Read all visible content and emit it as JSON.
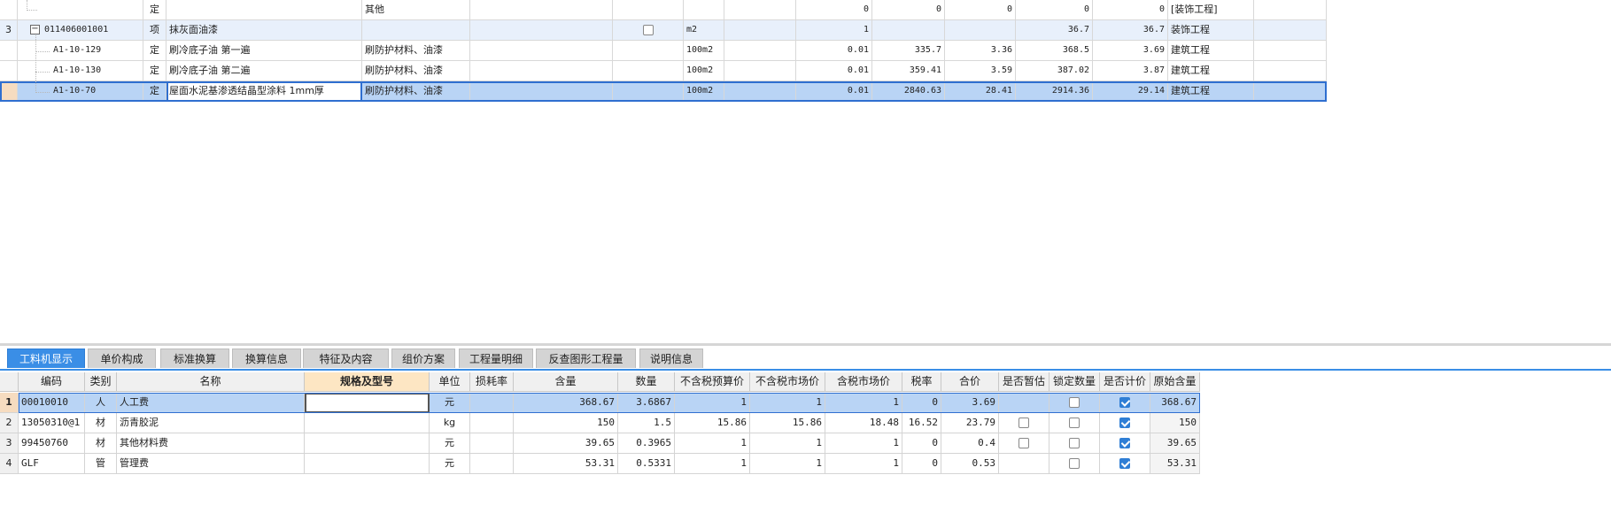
{
  "upper": {
    "rows": [
      {
        "num": "",
        "code": "",
        "type": "定",
        "name": "",
        "spec": "其他",
        "unit": "",
        "qty": "0",
        "v1": "0",
        "v2": "0",
        "v3": "0",
        "v4": "0",
        "cat": "[装饰工程]"
      },
      {
        "num": "3",
        "code": "011406001001",
        "type": "项",
        "name": "抹灰面油漆",
        "spec": "",
        "unit": "m2",
        "qty": "1",
        "v1": "",
        "v2": "",
        "v3": "36.7",
        "v4": "36.7",
        "cat": "装饰工程"
      },
      {
        "num": "",
        "code": "A1-10-129",
        "type": "定",
        "name": "刷冷底子油 第一遍",
        "spec": "刷防护材料、油漆",
        "unit": "100m2",
        "qty": "0.01",
        "v1": "335.7",
        "v2": "3.36",
        "v3": "368.5",
        "v4": "3.69",
        "cat": "建筑工程"
      },
      {
        "num": "",
        "code": "A1-10-130",
        "type": "定",
        "name": "刷冷底子油 第二遍",
        "spec": "刷防护材料、油漆",
        "unit": "100m2",
        "qty": "0.01",
        "v1": "359.41",
        "v2": "3.59",
        "v3": "387.02",
        "v4": "3.87",
        "cat": "建筑工程"
      },
      {
        "num": "",
        "code": "A1-10-70",
        "type": "定",
        "name": "屋面水泥基渗透结晶型涂料 1mm厚",
        "spec": "刷防护材料、油漆",
        "unit": "100m2",
        "qty": "0.01",
        "v1": "2840.63",
        "v2": "28.41",
        "v3": "2914.36",
        "v4": "29.14",
        "cat": "建筑工程"
      }
    ]
  },
  "tabs": [
    "工料机显示",
    "单价构成",
    "标准换算",
    "换算信息",
    "特征及内容",
    "组价方案",
    "工程量明细",
    "反查图形工程量",
    "说明信息"
  ],
  "lower": {
    "headers": [
      "编码",
      "类别",
      "名称",
      "规格及型号",
      "单位",
      "损耗率",
      "含量",
      "数量",
      "不含税预算价",
      "不含税市场价",
      "含税市场价",
      "税率",
      "合价",
      "是否暂估",
      "锁定数量",
      "是否计价",
      "原始含量"
    ],
    "rows": [
      {
        "num": "1",
        "code": "00010010",
        "cat": "人",
        "name": "人工费",
        "spec": "",
        "unit": "元",
        "loss": "",
        "content": "368.67",
        "qty": "3.6867",
        "p1": "1",
        "p2": "1",
        "p3": "1",
        "tax": "0",
        "total": "3.69",
        "est": null,
        "lock": false,
        "price": true,
        "orig": "368.67"
      },
      {
        "num": "2",
        "code": "13050310@1",
        "cat": "材",
        "name": "沥青胶泥",
        "spec": "",
        "unit": "kg",
        "loss": "",
        "content": "150",
        "qty": "1.5",
        "p1": "15.86",
        "p2": "15.86",
        "p3": "18.48",
        "tax": "16.52",
        "total": "23.79",
        "est": false,
        "lock": false,
        "price": true,
        "orig": "150"
      },
      {
        "num": "3",
        "code": "99450760",
        "cat": "材",
        "name": "其他材料费",
        "spec": "",
        "unit": "元",
        "loss": "",
        "content": "39.65",
        "qty": "0.3965",
        "p1": "1",
        "p2": "1",
        "p3": "1",
        "tax": "0",
        "total": "0.4",
        "est": false,
        "lock": false,
        "price": true,
        "orig": "39.65"
      },
      {
        "num": "4",
        "code": "GLF",
        "cat": "管",
        "name": "管理费",
        "spec": "",
        "unit": "元",
        "loss": "",
        "content": "53.31",
        "qty": "0.5331",
        "p1": "1",
        "p2": "1",
        "p3": "1",
        "tax": "0",
        "total": "0.53",
        "est": null,
        "lock": false,
        "price": true,
        "orig": "53.31"
      }
    ]
  },
  "colors": {
    "accent": "#3a8ee6",
    "selected_row": "#b9d4f5",
    "highlight_header": "#fde6c3"
  }
}
